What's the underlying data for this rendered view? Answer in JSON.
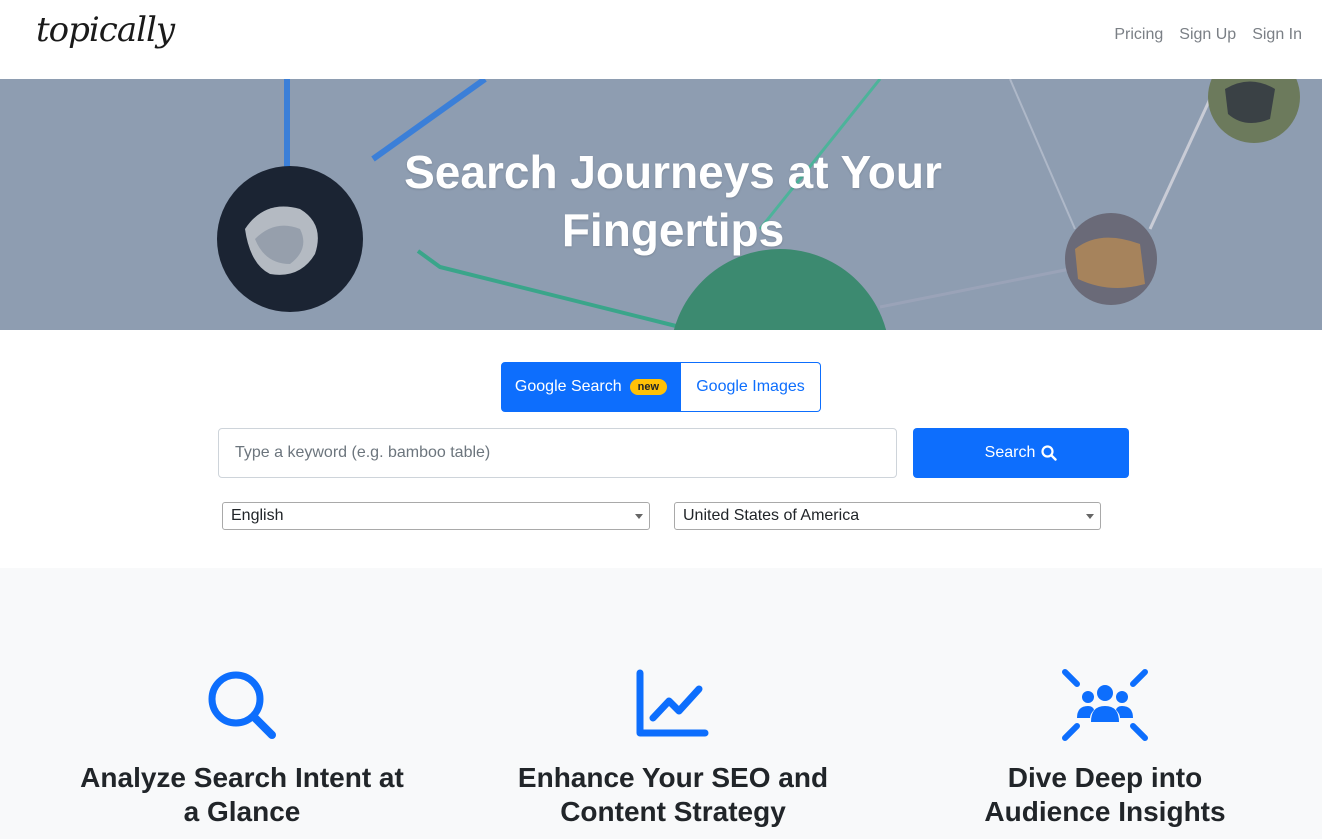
{
  "brand": {
    "logo_text": "topically"
  },
  "nav": {
    "items": [
      "Pricing",
      "Sign Up",
      "Sign In"
    ]
  },
  "hero": {
    "title_line1": "Search Journeys at Your",
    "title_line2": "Fingertips"
  },
  "search": {
    "tabs": [
      {
        "label": "Google Search",
        "badge": "new",
        "active": true
      },
      {
        "label": "Google Images",
        "active": false
      }
    ],
    "input_placeholder": "Type a keyword (e.g. bamboo table)",
    "input_value": "",
    "button_label": "Search",
    "language_selected": "English",
    "country_selected": "United States of America"
  },
  "features": [
    {
      "title_line1": "Analyze Search Intent at",
      "title_line2": "a Glance",
      "icon": "search-icon"
    },
    {
      "title_line1": "Enhance Your SEO and",
      "title_line2": "Content Strategy",
      "icon": "line-chart-icon"
    },
    {
      "title_line1": "Dive Deep into",
      "title_line2": "Audience Insights",
      "icon": "audience-focus-icon"
    }
  ],
  "colors": {
    "primary": "#0d6efd",
    "badge": "#ffc107",
    "hero_bg": "#8e9db1",
    "features_bg": "#f8f9fa"
  }
}
